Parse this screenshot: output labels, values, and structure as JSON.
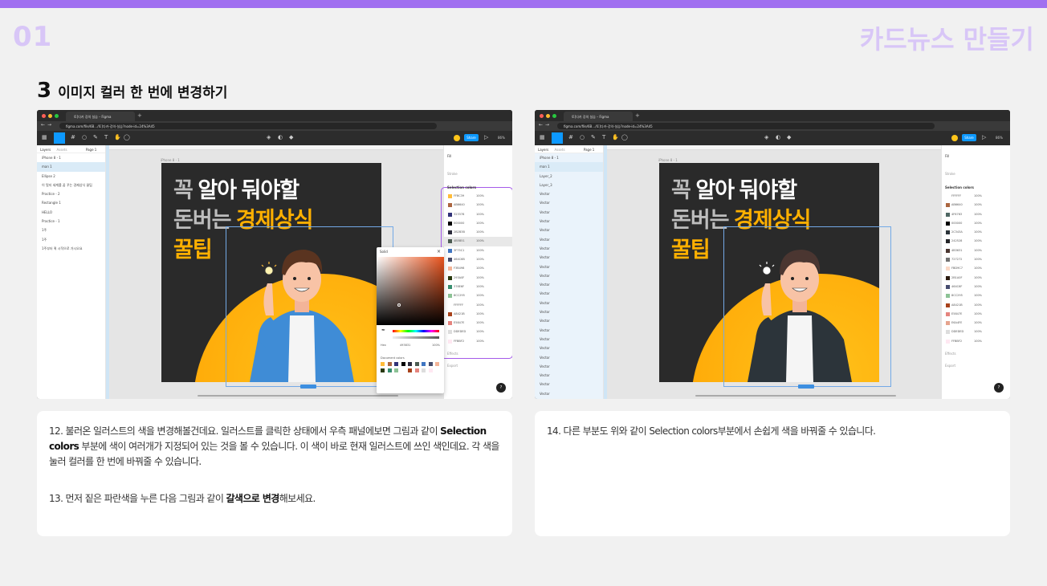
{
  "page": {
    "number": "01",
    "brand": "카드뉴스 만들기",
    "step_number": "3",
    "step_title": "이미지 컬러 한 번에 변경하기"
  },
  "colors": {
    "accent": "#a06ff0",
    "accent_light": "#d8c6f7",
    "figma_blue": "#0d99ff",
    "selection_outline": "#a55be8",
    "card_title_gray": "#bdbdbd",
    "card_title_orange": "#ffb000",
    "sun_orange": "#ffb300"
  },
  "figma": {
    "tab_title": "토]다카 강의 실습 – Figma",
    "url": "figma.com/file/6B…/토]다카-강의-실습?node-id=24%3A45",
    "share_label": "Share",
    "zoom": "86%",
    "layers_tab": "Layers",
    "assets_tab": "Assets",
    "page_label": "Page 1",
    "frame_label": "iPhone 8 - 1",
    "fill_label": "Fill",
    "stroke_label": "Stroke",
    "selection_colors_label": "Selection colors",
    "effects_label": "Effects",
    "export_label": "Export",
    "card_text": {
      "line1_a": "꼭",
      "line1_b": "알아 둬야할",
      "line2_a": "돈버는",
      "line2_b": "경제상식",
      "line3": "꿀팁"
    }
  },
  "left_shot": {
    "layers": [
      "iPhone 8 - 1",
      "man 1",
      "Ellipse 2",
      "이 멋지 세계를 꿈 꾸는 경제상식 꿀팁",
      "Practice - 2",
      "Rectangle 1",
      "HELLO",
      "Practice - 1",
      "1주",
      "1주",
      "1주부터 퀵 시작으로 가시오요"
    ],
    "selected_layer_index": 1,
    "selection_colors": [
      {
        "hex": "FFBC39",
        "pct": "100%",
        "color": "#ffbc39"
      },
      {
        "hex": "AB6640",
        "pct": "100%",
        "color": "#ab6640"
      },
      {
        "hex": "323378",
        "pct": "100%",
        "color": "#323378"
      },
      {
        "hex": "000000",
        "pct": "100%",
        "color": "#000000"
      },
      {
        "hex": "2B2B3B",
        "pct": "100%",
        "color": "#2b2b3b"
      },
      {
        "hex": "4B5B51",
        "pct": "100%",
        "color": "#4b5b51"
      },
      {
        "hex": "3F75C1",
        "pct": "100%",
        "color": "#3f75c1"
      },
      {
        "hex": "464C6B",
        "pct": "100%",
        "color": "#464c6b"
      },
      {
        "hex": "F3B498",
        "pct": "100%",
        "color": "#f3b498"
      },
      {
        "hex": "293A0F",
        "pct": "100%",
        "color": "#293a0f"
      },
      {
        "hex": "378E6F",
        "pct": "100%",
        "color": "#378e6f"
      },
      {
        "hex": "8CC295",
        "pct": "100%",
        "color": "#8cc295"
      },
      {
        "hex": "FFFFFF",
        "pct": "100%",
        "color": "#ffffff"
      },
      {
        "hex": "A8421B",
        "pct": "100%",
        "color": "#a8421b"
      },
      {
        "hex": "E5847E",
        "pct": "100%",
        "color": "#e5847e"
      },
      {
        "hex": "DDEDED",
        "pct": "100%",
        "color": "#dddddd"
      },
      {
        "hex": "FFBBF2",
        "pct": "100%",
        "color": "#ffe8f2"
      }
    ],
    "highlighted_color_index": 5,
    "picker": {
      "title": "Solid",
      "hex_label": "Hex",
      "hex_value": "493831",
      "opacity": "100%",
      "document_colors_label": "Document colors"
    }
  },
  "right_shot": {
    "layers": [
      "iPhone 8 - 1",
      "man 1",
      "Layer_2",
      "Layer_3",
      "Vector",
      "Vector",
      "Vector",
      "Vector",
      "Vector",
      "Vector",
      "Vector",
      "Vector",
      "Vector",
      "Vector",
      "Vector",
      "Vector",
      "Vector",
      "Vector",
      "Vector",
      "Vector",
      "Vector",
      "Vector",
      "Vector",
      "Vector",
      "Vector",
      "Vector",
      "Vector",
      "Vector"
    ],
    "selected_layer_index": 1,
    "selection_colors": [
      {
        "hex": "FFFFFF",
        "pct": "100%",
        "color": "#ffffff"
      },
      {
        "hex": "AB6640",
        "pct": "100%",
        "color": "#ab6640"
      },
      {
        "hex": "4F6763",
        "pct": "100%",
        "color": "#4f6763"
      },
      {
        "hex": "000000",
        "pct": "100%",
        "color": "#000000"
      },
      {
        "hex": "2C343A",
        "pct": "100%",
        "color": "#2c343a"
      },
      {
        "hex": "242528",
        "pct": "100%",
        "color": "#242528"
      },
      {
        "hex": "4B3631",
        "pct": "100%",
        "color": "#4b3631"
      },
      {
        "hex": "727272",
        "pct": "100%",
        "color": "#727272"
      },
      {
        "hex": "FBD9C7",
        "pct": "100%",
        "color": "#fbd9c7"
      },
      {
        "hex": "2B1A0F",
        "pct": "100%",
        "color": "#2b1a0f"
      },
      {
        "hex": "464C6F",
        "pct": "100%",
        "color": "#464c6f"
      },
      {
        "hex": "8CC295",
        "pct": "100%",
        "color": "#8cc295"
      },
      {
        "hex": "A8421B",
        "pct": "100%",
        "color": "#a8421b"
      },
      {
        "hex": "E5847E",
        "pct": "100%",
        "color": "#e5847e"
      },
      {
        "hex": "E6A4FE",
        "pct": "100%",
        "color": "#e6a48e"
      },
      {
        "hex": "DDEDED",
        "pct": "100%",
        "color": "#dddddd"
      },
      {
        "hex": "FFBBF2",
        "pct": "100%",
        "color": "#ffe8f2"
      }
    ]
  },
  "captions": {
    "c12_a": "12. 불러온 일러스트의 색을 변경해볼건데요. 일러스트를 클릭한 상태에서 우측 패널에보면 그림과 같이 ",
    "c12_b": "Selection colors",
    "c12_c": " 부분에 색이 여러개가 지정되어 있는 것을 볼 수 있습니다. 이 색이 바로 현재 일러스트에 쓰인 색인데요. 각 색을 눌러 컬러를 한 번에 바꿔줄 수 있습니다.",
    "c13_a": "13. 먼저 짙은 파란색을 누른 다음 그림과 같이 ",
    "c13_b": "갈색으로 변경",
    "c13_c": "해보세요.",
    "c14": "14. 다른 부분도 위와 같이 Selection colors부분에서 손쉽게 색을 바꿔줄 수 있습니다."
  }
}
